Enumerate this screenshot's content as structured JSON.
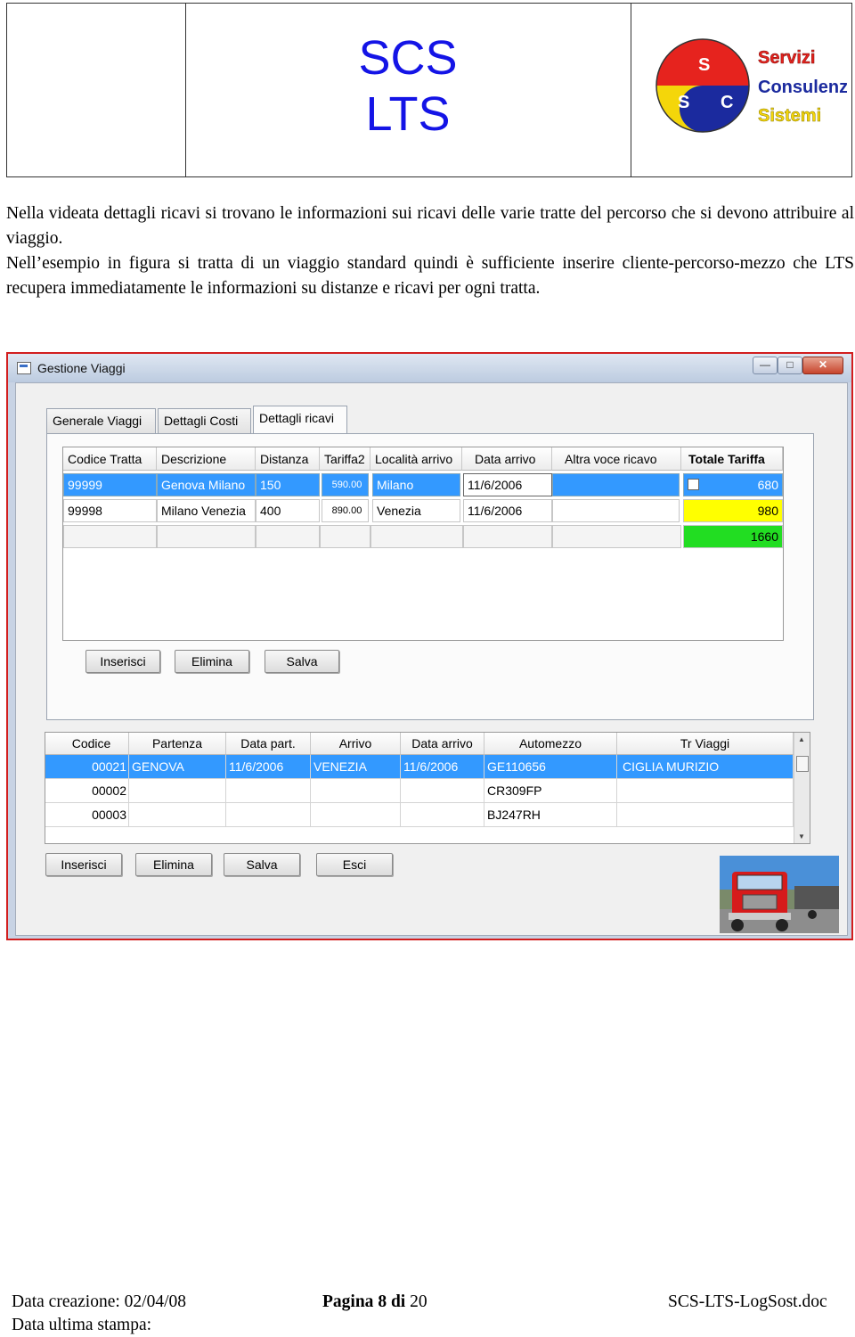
{
  "header": {
    "title_line1": "SCS",
    "title_line2": "LTS",
    "logo": {
      "letters": [
        "S",
        "S",
        "C"
      ],
      "words": [
        "Servizi",
        "Consulenza",
        "Sistemi"
      ]
    }
  },
  "intro": {
    "p1": "Nella videata dettagli ricavi si trovano le informazioni sui ricavi delle varie tratte del percorso che si devono attribuire al viaggio.",
    "p2": "Nell’esempio in figura si tratta di un viaggio standard quindi è sufficiente inserire cliente-percorso-mezzo che LTS recupera immediatamente le informazioni su distanze e ricavi per ogni tratta."
  },
  "window": {
    "title": "Gestione Viaggi",
    "controls": {
      "minimize": "—",
      "maximize": "□",
      "close": "✕"
    },
    "tabs": [
      "Generale Viaggi",
      "Dettagli Costi",
      "Dettagli ricavi"
    ],
    "active_tab": 2,
    "ricavi_grid": {
      "columns": [
        "Codice Tratta",
        "Descrizione",
        "Distanza",
        "Tariffa2",
        "Località arrivo",
        "Data arrivo",
        "Altra voce ricavo",
        "Totale Tariffa"
      ],
      "rows": [
        [
          "99999",
          "Genova Milano",
          "150",
          "590.00",
          "Milano",
          "11/6/2006",
          "",
          "680"
        ],
        [
          "99998",
          "Milano Venezia",
          "400",
          "890.00",
          "Venezia",
          "11/6/2006",
          "",
          "980"
        ]
      ],
      "total": "1660"
    },
    "inner_buttons": [
      "Inserisci",
      "Elimina",
      "Salva"
    ],
    "viaggi_grid": {
      "columns": [
        "Codice",
        "Partenza",
        "Data part.",
        "Arrivo",
        "Data arrivo",
        "Automezzo",
        "Tr Viaggi"
      ],
      "rows": [
        [
          "00021",
          "GENOVA",
          "11/6/2006",
          "VENEZIA",
          "11/6/2006",
          "GE110656",
          "CIGLIA MURIZIO"
        ],
        [
          "00002",
          "",
          "",
          "",
          "",
          "CR309FP",
          ""
        ],
        [
          "00003",
          "",
          "",
          "",
          "",
          "BJ247RH",
          ""
        ]
      ]
    },
    "outer_buttons": [
      "Inserisci",
      "Elimina",
      "Salva",
      "Esci"
    ]
  },
  "footer": {
    "created": "Data creazione: 02/04/08",
    "printed": "Data ultima stampa:",
    "page_label": "Pagina",
    "page_num": "8",
    "page_of": "di",
    "page_total": "20",
    "filename": "SCS-LTS-LogSost.doc"
  },
  "colors": {
    "title_blue": "#1414e6",
    "selection": "#3399ff",
    "yellow": "#ffff00",
    "green": "#22dd22",
    "window_border": "#d21e1e"
  }
}
